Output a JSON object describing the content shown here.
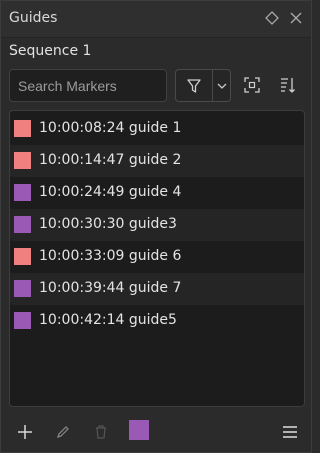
{
  "panel": {
    "title": "Guides",
    "pin_icon": "diamond-icon",
    "close_icon": "close-icon"
  },
  "sequence": {
    "name": "Sequence 1"
  },
  "search": {
    "placeholder": "Search Markers",
    "value": ""
  },
  "toolbar": {
    "filter_icon": "filter-icon",
    "filter_dropdown_icon": "chevron-down-icon",
    "fit_icon": "focus-frame-icon",
    "sort_icon": "sort-icon"
  },
  "markers": [
    {
      "timecode": "10:00:08:24",
      "name": "guide 1",
      "color": "#f08080"
    },
    {
      "timecode": "10:00:14:47",
      "name": "guide 2",
      "color": "#f08080"
    },
    {
      "timecode": "10:00:24:49",
      "name": "guide 4",
      "color": "#9b59b6"
    },
    {
      "timecode": "10:00:30:30",
      "name": "guide3",
      "color": "#9b59b6"
    },
    {
      "timecode": "10:00:33:09",
      "name": "guide 6",
      "color": "#f08080"
    },
    {
      "timecode": "10:00:39:44",
      "name": "guide 7",
      "color": "#9b59b6"
    },
    {
      "timecode": "10:00:42:14",
      "name": "guide5",
      "color": "#9b59b6"
    }
  ],
  "bottom_bar": {
    "add_icon": "plus-icon",
    "edit_icon": "pencil-icon",
    "delete_icon": "trash-icon",
    "current_color": "#9b59b6",
    "menu_icon": "hamburger-menu-icon"
  },
  "colors": {
    "accent_red": "#f08080",
    "accent_purple": "#9b59b6",
    "background": "#2b2b2b",
    "list_background": "#1c1c1c"
  }
}
